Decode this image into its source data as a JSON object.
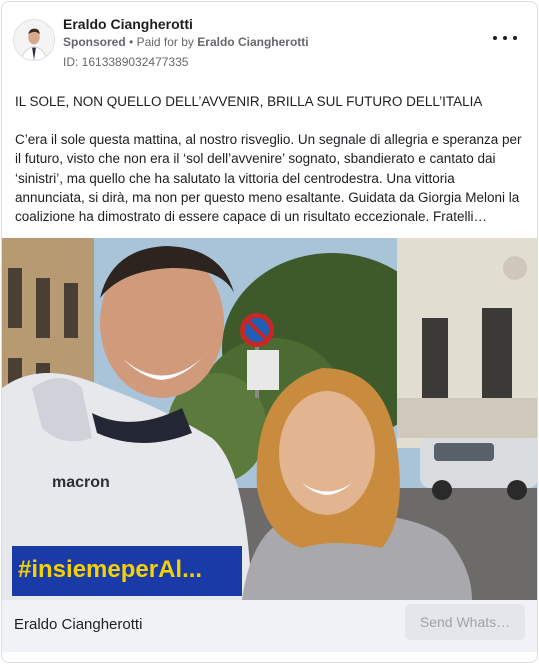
{
  "ad": {
    "advertiser_name": "Eraldo Ciangherotti",
    "sponsored_label": "Sponsored",
    "separator": "•",
    "paid_for_prefix": "Paid for by",
    "paid_for_name": "Eraldo Ciangherotti",
    "id_label": "ID: 1613389032477335"
  },
  "post": {
    "headline": "IL SOLE, NON QUELLO DELL’AVVENIR, BRILLA SUL FUTURO DELL’ITALIA",
    "paragraph": "C’era il sole questa mattina, al nostro risveglio. Un segnale di allegria e speranza per il futuro, visto che non era il ‘sol dell’avvenire’ sognato, sbandierato e cantato dai ‘sinistri’, ma quello che ha salutato la vittoria del centrodestra. Una vittoria annunciata, si dirà, ma non per questo meno esaltante. Guidata da Giorgia Meloni la coalizione ha dimostrato di essere capace di un risultato eccezionale. Fratelli…"
  },
  "photo": {
    "sweatshirt_brand": "macron",
    "banner_text": "#insiemeperAl..."
  },
  "footer": {
    "page_name": "Eraldo Ciangherotti",
    "cta_label": "Send Whats…"
  },
  "icons": {
    "more": "more-options-icon"
  },
  "colors": {
    "text_primary": "#1c1e21",
    "text_secondary": "#65676b",
    "footer_bg": "#f0f2f5",
    "cta_bg": "#e4e6eb",
    "cta_text": "#9ea3aa"
  }
}
